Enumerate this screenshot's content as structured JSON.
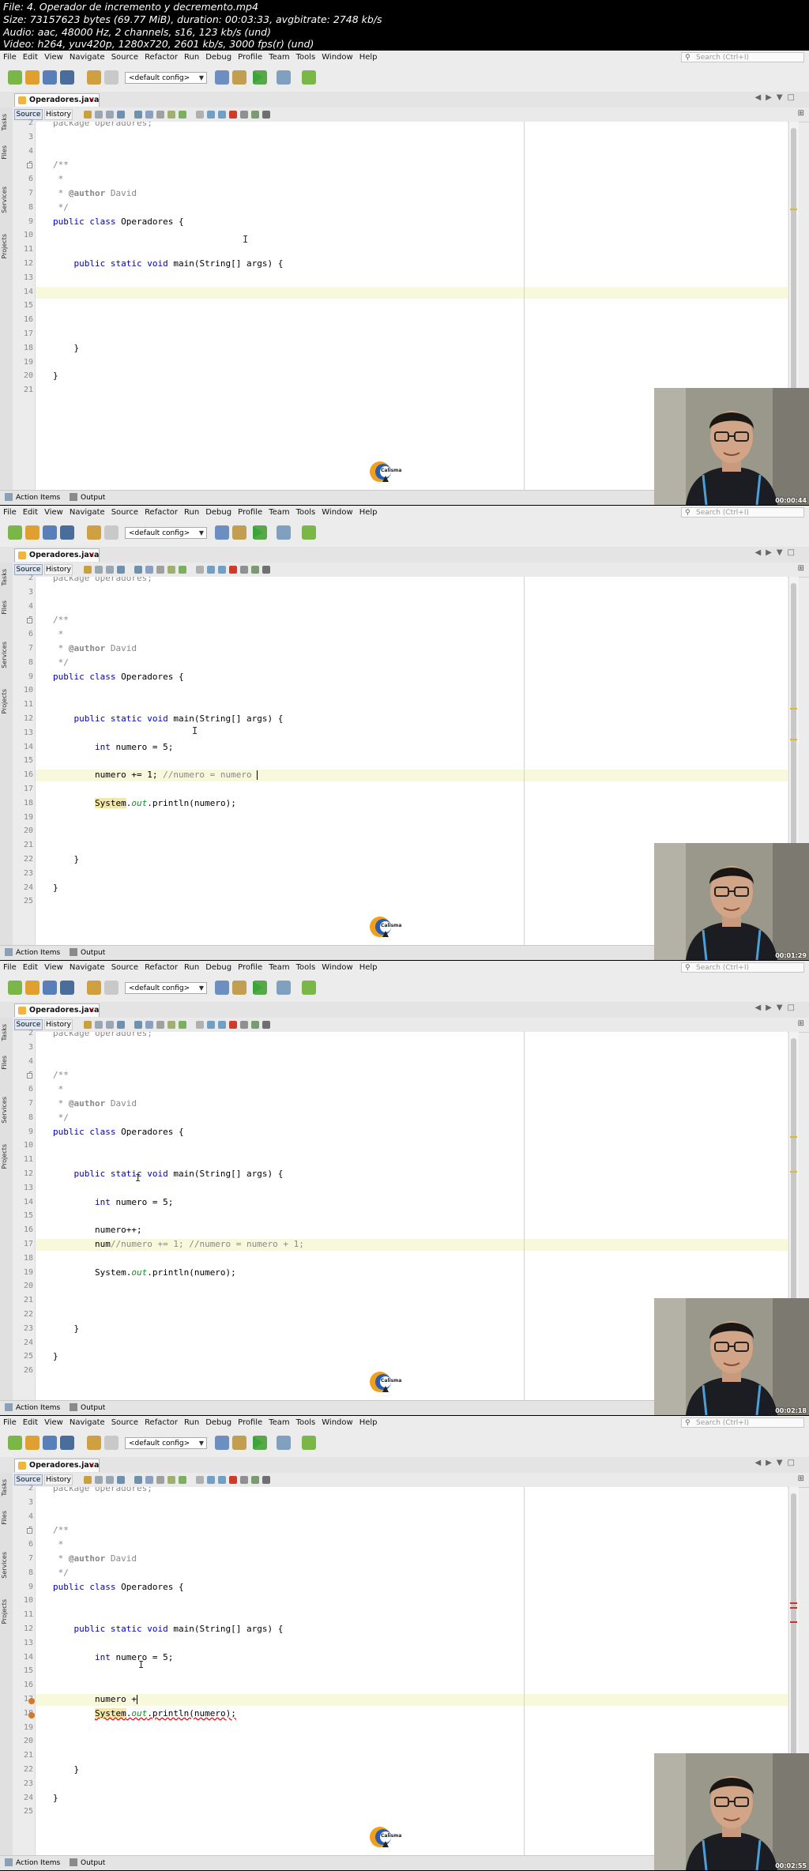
{
  "video_info": [
    "File: 4. Operador de incremento y decremento.mp4",
    "Size: 73157623 bytes (69.77 MiB), duration: 00:03:33, avgbitrate: 2748 kb/s",
    "Audio: aac, 48000 Hz, 2 channels, s16, 123 kb/s (und)",
    "Video: h264, yuv420p, 1280x720, 2601 kb/s, 3000 fps(r) (und)"
  ],
  "ide": {
    "menu": [
      "File",
      "Edit",
      "View",
      "Navigate",
      "Source",
      "Refactor",
      "Run",
      "Debug",
      "Profile",
      "Team",
      "Tools",
      "Window",
      "Help"
    ],
    "search_placeholder": "Search (Ctrl+I)",
    "config": "<default config>",
    "file_tab": "Operadores.java",
    "source_label": "Source",
    "history_label": "History",
    "side_labels": [
      "Tasks",
      "Files",
      "Services",
      "Projects"
    ],
    "bottom": [
      "Action Items",
      "Output"
    ],
    "logo_text": "Calisma"
  },
  "frames": [
    {
      "timestamp": "00:00:44",
      "lines": [
        {
          "n": "2",
          "t": [
            [
              "package operadores;",
              "cm"
            ]
          ]
        },
        {
          "n": "3",
          "t": []
        },
        {
          "n": "4",
          "t": []
        },
        {
          "n": "5",
          "t": [
            [
              "/**",
              "cm"
            ]
          ]
        },
        {
          "n": "6",
          "t": [
            [
              " *",
              "cm"
            ]
          ]
        },
        {
          "n": "7",
          "t": [
            [
              " * ",
              "cm"
            ],
            [
              "@author",
              "tag"
            ],
            [
              " David",
              "cm"
            ]
          ]
        },
        {
          "n": "8",
          "t": [
            [
              " */",
              "cm"
            ]
          ]
        },
        {
          "n": "9",
          "t": [
            [
              "public class ",
              "kw"
            ],
            [
              "Operadores {",
              ""
            ]
          ]
        },
        {
          "n": "10",
          "t": []
        },
        {
          "n": "11",
          "t": []
        },
        {
          "n": "12",
          "t": [
            [
              "    public static void ",
              "kw"
            ],
            [
              "main(String[] ",
              ""
            ],
            [
              "args",
              ""
            ],
            [
              ") {",
              ""
            ]
          ]
        },
        {
          "n": "13",
          "t": []
        },
        {
          "n": "14",
          "t": [],
          "hl": true
        },
        {
          "n": "15",
          "t": []
        },
        {
          "n": "16",
          "t": []
        },
        {
          "n": "17",
          "t": []
        },
        {
          "n": "18",
          "t": [
            [
              "    }",
              ""
            ]
          ]
        },
        {
          "n": "19",
          "t": []
        },
        {
          "n": "20",
          "t": [
            [
              "}",
              ""
            ]
          ]
        },
        {
          "n": "21",
          "t": []
        }
      ]
    },
    {
      "timestamp": "00:01:29",
      "lines": [
        {
          "n": "2",
          "t": [
            [
              "package operadores;",
              "cm"
            ]
          ]
        },
        {
          "n": "3",
          "t": []
        },
        {
          "n": "4",
          "t": []
        },
        {
          "n": "5",
          "t": [
            [
              "/**",
              "cm"
            ]
          ]
        },
        {
          "n": "6",
          "t": [
            [
              " *",
              "cm"
            ]
          ]
        },
        {
          "n": "7",
          "t": [
            [
              " * ",
              "cm"
            ],
            [
              "@author",
              "tag"
            ],
            [
              " David",
              "cm"
            ]
          ]
        },
        {
          "n": "8",
          "t": [
            [
              " */",
              "cm"
            ]
          ]
        },
        {
          "n": "9",
          "t": [
            [
              "public class ",
              "kw"
            ],
            [
              "Operadores {",
              ""
            ]
          ]
        },
        {
          "n": "10",
          "t": []
        },
        {
          "n": "11",
          "t": []
        },
        {
          "n": "12",
          "t": [
            [
              "    public static void ",
              "kw"
            ],
            [
              "main(String[] args) {",
              ""
            ]
          ]
        },
        {
          "n": "13",
          "t": []
        },
        {
          "n": "14",
          "t": [
            [
              "        int ",
              "kw"
            ],
            [
              "numero = 5;",
              ""
            ]
          ]
        },
        {
          "n": "15",
          "t": []
        },
        {
          "n": "16",
          "t": [
            [
              "        numero += 1; ",
              ""
            ],
            [
              "//numero = numero ",
              "cm"
            ]
          ],
          "hl": true,
          "caret": true
        },
        {
          "n": "17",
          "t": []
        },
        {
          "n": "18",
          "t": [
            [
              "        ",
              ""
            ],
            [
              "System",
              "sys"
            ],
            [
              ".",
              ""
            ],
            [
              "out",
              "out"
            ],
            [
              ".println(numero);",
              ""
            ]
          ]
        },
        {
          "n": "19",
          "t": []
        },
        {
          "n": "20",
          "t": []
        },
        {
          "n": "21",
          "t": []
        },
        {
          "n": "22",
          "t": [
            [
              "    }",
              ""
            ]
          ]
        },
        {
          "n": "23",
          "t": []
        },
        {
          "n": "24",
          "t": [
            [
              "}",
              ""
            ]
          ]
        },
        {
          "n": "25",
          "t": []
        }
      ]
    },
    {
      "timestamp": "00:02:18",
      "lines": [
        {
          "n": "2",
          "t": [
            [
              "package operadores;",
              "cm"
            ]
          ]
        },
        {
          "n": "3",
          "t": []
        },
        {
          "n": "4",
          "t": []
        },
        {
          "n": "5",
          "t": [
            [
              "/**",
              "cm"
            ]
          ]
        },
        {
          "n": "6",
          "t": [
            [
              " *",
              "cm"
            ]
          ]
        },
        {
          "n": "7",
          "t": [
            [
              " * ",
              "cm"
            ],
            [
              "@author",
              "tag"
            ],
            [
              " David",
              "cm"
            ]
          ]
        },
        {
          "n": "8",
          "t": [
            [
              " */",
              "cm"
            ]
          ]
        },
        {
          "n": "9",
          "t": [
            [
              "public class ",
              "kw"
            ],
            [
              "Operadores {",
              ""
            ]
          ]
        },
        {
          "n": "10",
          "t": []
        },
        {
          "n": "11",
          "t": []
        },
        {
          "n": "12",
          "t": [
            [
              "    public static void ",
              "kw"
            ],
            [
              "main(String[] args) {",
              ""
            ]
          ]
        },
        {
          "n": "13",
          "t": []
        },
        {
          "n": "14",
          "t": [
            [
              "        int ",
              "kw"
            ],
            [
              "numero = 5;",
              ""
            ]
          ]
        },
        {
          "n": "15",
          "t": []
        },
        {
          "n": "16",
          "t": [
            [
              "        numero++;",
              ""
            ]
          ]
        },
        {
          "n": "17",
          "t": [
            [
              "        num",
              ""
            ],
            [
              "//numero += 1; //numero = numero + 1;",
              "cm"
            ]
          ],
          "hl": true
        },
        {
          "n": "18",
          "t": []
        },
        {
          "n": "19",
          "t": [
            [
              "        System.",
              ""
            ],
            [
              "out",
              "out"
            ],
            [
              ".println(numero);",
              ""
            ]
          ]
        },
        {
          "n": "20",
          "t": []
        },
        {
          "n": "21",
          "t": []
        },
        {
          "n": "22",
          "t": []
        },
        {
          "n": "23",
          "t": [
            [
              "    }",
              ""
            ]
          ]
        },
        {
          "n": "24",
          "t": []
        },
        {
          "n": "25",
          "t": [
            [
              "}",
              ""
            ]
          ]
        },
        {
          "n": "26",
          "t": []
        }
      ]
    },
    {
      "timestamp": "00:02:55",
      "lines": [
        {
          "n": "2",
          "t": [
            [
              "package operadores;",
              "cm"
            ]
          ]
        },
        {
          "n": "3",
          "t": []
        },
        {
          "n": "4",
          "t": []
        },
        {
          "n": "5",
          "t": [
            [
              "/**",
              "cm"
            ]
          ]
        },
        {
          "n": "6",
          "t": [
            [
              " *",
              "cm"
            ]
          ]
        },
        {
          "n": "7",
          "t": [
            [
              " * ",
              "cm"
            ],
            [
              "@author",
              "tag"
            ],
            [
              " David",
              "cm"
            ]
          ]
        },
        {
          "n": "8",
          "t": [
            [
              " */",
              "cm"
            ]
          ]
        },
        {
          "n": "9",
          "t": [
            [
              "public class ",
              "kw"
            ],
            [
              "Operadores {",
              ""
            ]
          ]
        },
        {
          "n": "10",
          "t": []
        },
        {
          "n": "11",
          "t": []
        },
        {
          "n": "12",
          "t": [
            [
              "    public static void ",
              "kw"
            ],
            [
              "main(String[] args) {",
              ""
            ]
          ]
        },
        {
          "n": "13",
          "t": []
        },
        {
          "n": "14",
          "t": [
            [
              "        int ",
              "kw"
            ],
            [
              "numero = 5;",
              ""
            ]
          ]
        },
        {
          "n": "15",
          "t": []
        },
        {
          "n": "16",
          "t": []
        },
        {
          "n": "17",
          "t": [
            [
              "        numero +",
              ""
            ]
          ],
          "hl": true,
          "caret": true,
          "err": true
        },
        {
          "n": "18",
          "t": [
            [
              "        ",
              ""
            ],
            [
              "System",
              "sys"
            ],
            [
              ".",
              ""
            ],
            [
              "out",
              "out"
            ],
            [
              ".println(numero);",
              ""
            ]
          ],
          "err": true,
          "under": true
        },
        {
          "n": "19",
          "t": []
        },
        {
          "n": "20",
          "t": []
        },
        {
          "n": "21",
          "t": []
        },
        {
          "n": "22",
          "t": [
            [
              "    }",
              ""
            ]
          ]
        },
        {
          "n": "23",
          "t": []
        },
        {
          "n": "24",
          "t": [
            [
              "}",
              ""
            ]
          ]
        },
        {
          "n": "25",
          "t": []
        }
      ]
    }
  ]
}
